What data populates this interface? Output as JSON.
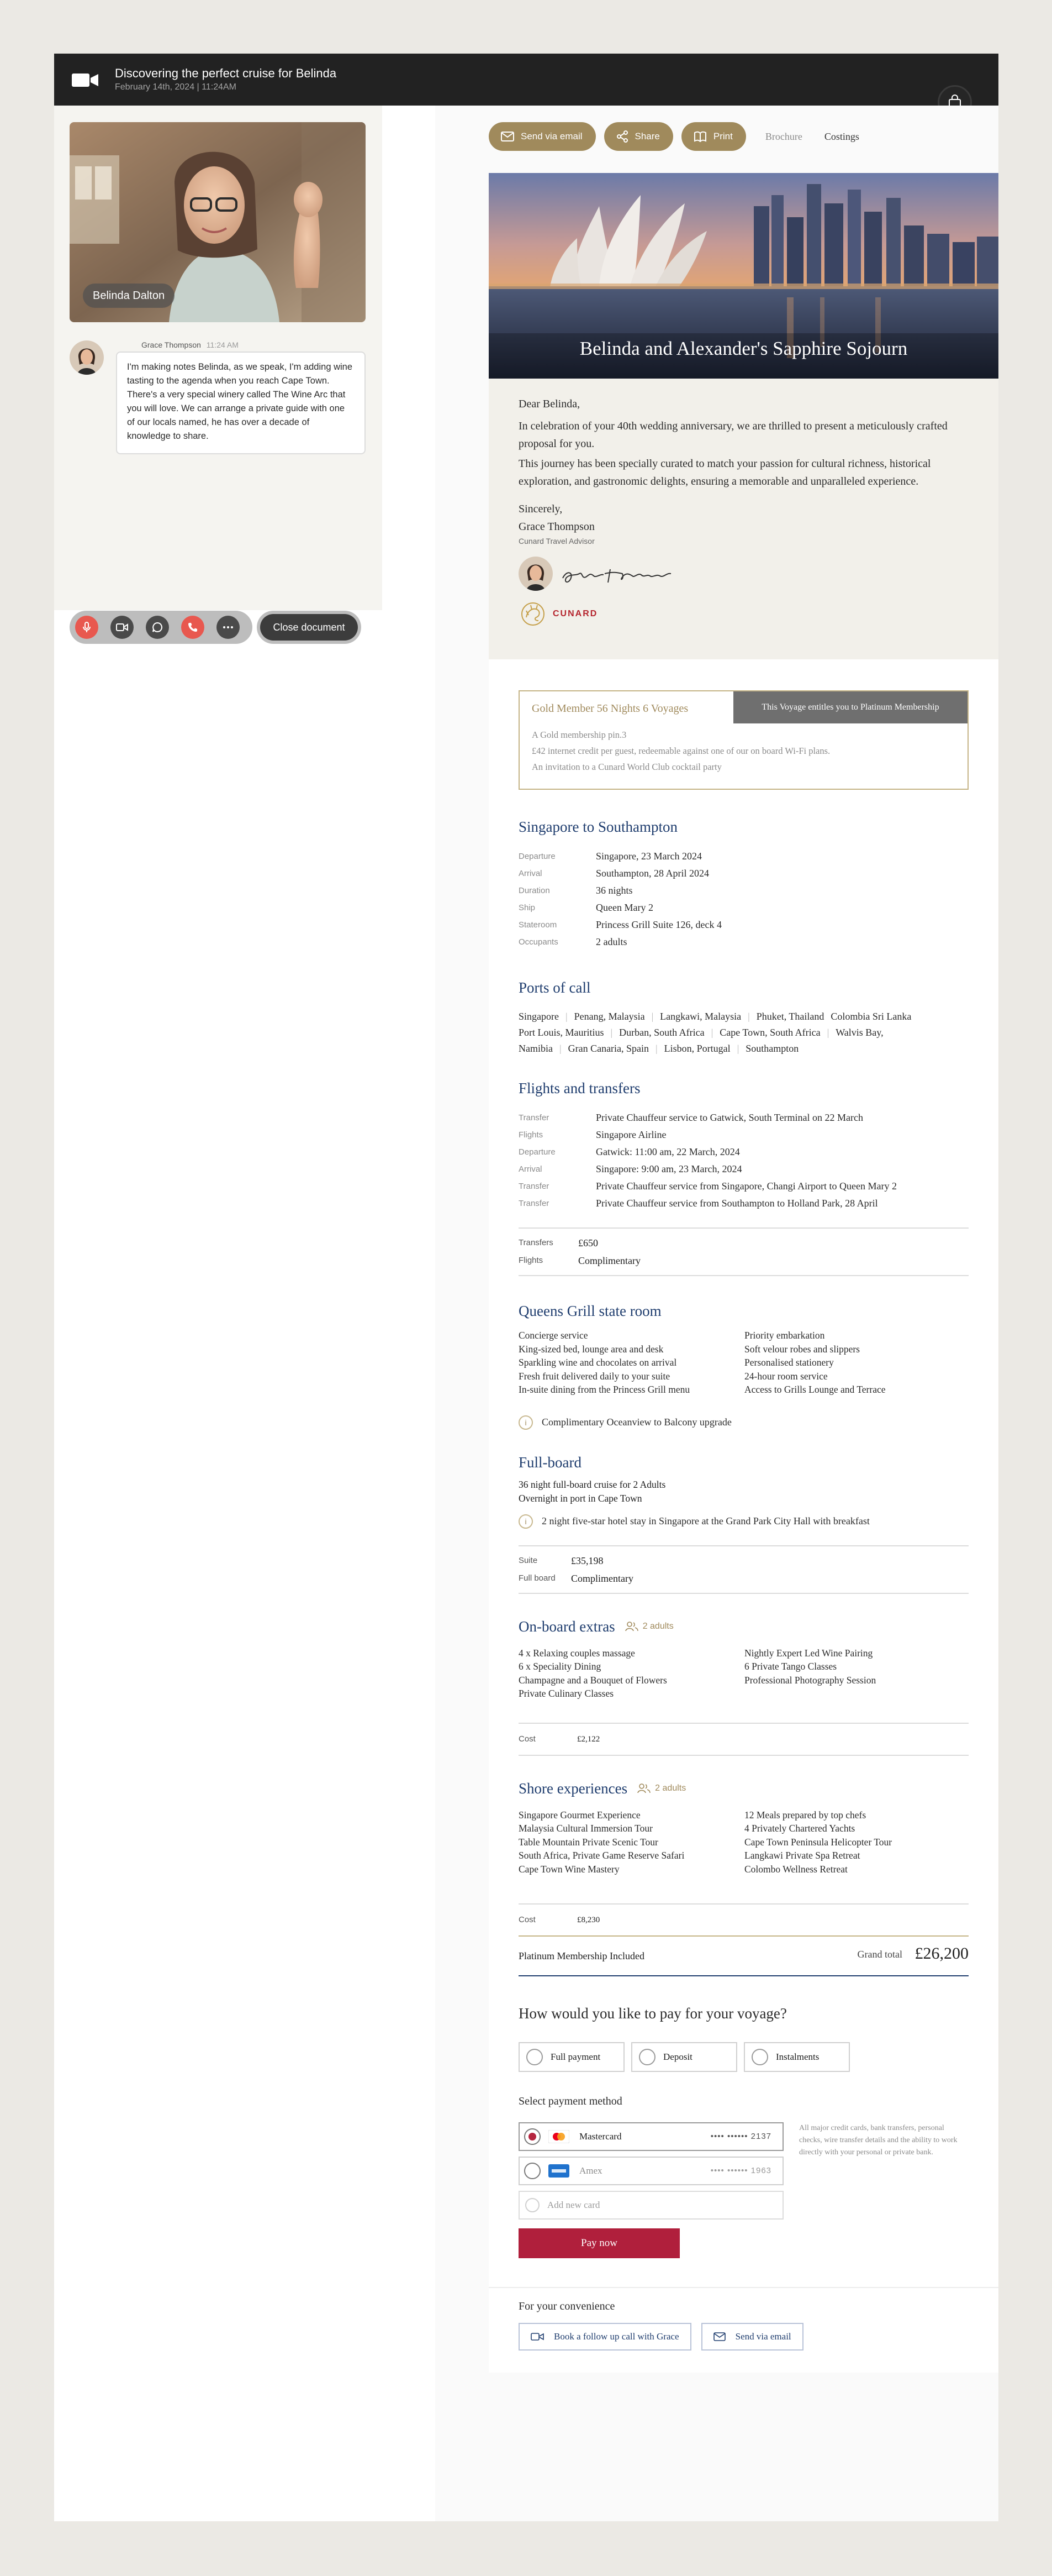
{
  "call": {
    "title": "Discovering the perfect cruise for Belinda",
    "subtitle": "February 14th, 2024 | 11:24AM",
    "participant_name": "Belinda Dalton"
  },
  "chat": {
    "author": "Grace Thompson",
    "time": "11:24 AM",
    "message": "I'm making notes Belinda, as we speak, I'm adding wine tasting to the agenda when you reach Cape Town. There's a very special winery called The Wine Arc that you will love. We can arrange a private guide with one of our locals named, he has over a decade of knowledge to share."
  },
  "controls": {
    "close_label": "Close document",
    "colors": {
      "mic": "#e8584f",
      "end": "#e8584f",
      "neutral": "#4a4a4a"
    }
  },
  "toolbar": {
    "email": "Send via email",
    "share": "Share",
    "print": "Print",
    "brochure": "Brochure",
    "costings": "Costings"
  },
  "hero": {
    "title": "Belinda and Alexander's Sapphire Sojourn"
  },
  "letter": {
    "greeting": "Dear Belinda,",
    "p1": "In celebration of your 40th wedding anniversary, we are thrilled to present a meticulously crafted proposal for you.",
    "p2": "This journey has been specially curated to match your passion for cultural richness, historical exploration, and gastronomic delights, ensuring a memorable and unparalleled experience.",
    "closing": "Sincerely,",
    "name": "Grace Thompson",
    "role": "Cunard Travel Advisor",
    "signature": "grace thompson",
    "brand": "CUNARD"
  },
  "membership": {
    "title": "Gold Member  56 Nights  6 Voyages",
    "banner": "This Voyage entitles you to Platinum Membership",
    "items": [
      "A Gold membership pin.3",
      "£42 internet credit per guest, redeemable against one of our on board Wi-Fi plans.",
      "An invitation to a Cunard World Club cocktail party"
    ]
  },
  "route": {
    "title": "Singapore to Southampton",
    "rows": [
      {
        "k": "Departure",
        "v": "Singapore, 23 March 2024"
      },
      {
        "k": "Arrival",
        "v": "Southampton, 28 April 2024"
      },
      {
        "k": "Duration",
        "v": "36 nights"
      },
      {
        "k": "Ship",
        "v": "Queen Mary 2"
      },
      {
        "k": "Stateroom",
        "v": "Princess Grill Suite 126, deck 4"
      },
      {
        "k": "Occupants",
        "v": "2 adults"
      }
    ]
  },
  "ports": {
    "title": "Ports of call",
    "line1": [
      "Singapore",
      "Penang, Malaysia",
      "Langkawi, Malaysia",
      "Phuket, Thailand",
      "Colombia  Sri Lanka"
    ],
    "line2": [
      "Port Louis, Mauritius",
      "Durban, South Africa",
      "Cape Town, South Africa",
      "Walvis Bay,"
    ],
    "line3": [
      "Namibia",
      "Gran Canaria, Spain",
      "Lisbon, Portugal",
      "Southampton"
    ]
  },
  "flights": {
    "title": "Flights and transfers",
    "rows": [
      {
        "k": "Transfer",
        "v": "Private Chauffeur service to Gatwick, South Terminal on 22 March"
      },
      {
        "k": "Flights",
        "v": "Singapore Airline"
      },
      {
        "k": "Departure",
        "v": "Gatwick: 11:00 am,  22 March, 2024"
      },
      {
        "k": "Arrival",
        "v": "Singapore: 9:00 am,  23 March, 2024"
      },
      {
        "k": "Transfer",
        "v": "Private Chauffeur service from Singapore, Changi Airport to Queen Mary 2"
      },
      {
        "k": "Transfer",
        "v": "Private Chauffeur service from Southampton to Holland Park, 28 April"
      }
    ],
    "costs": [
      {
        "k": "Transfers",
        "v": "£650"
      },
      {
        "k": "Flights",
        "v": "Complimentary"
      }
    ]
  },
  "grill": {
    "title": "Queens Grill state room",
    "left": [
      "Concierge service",
      "King-sized bed, lounge area and desk",
      "Sparkling wine and chocolates on arrival",
      "Fresh fruit delivered daily to your suite",
      "In-suite dining from the Princess Grill menu"
    ],
    "right": [
      "Priority embarkation",
      "Soft velour robes and slippers",
      "Personalised stationery",
      "24-hour room service",
      "Access to Grills Lounge and Terrace"
    ],
    "note": "Complimentary Oceanview to Balcony upgrade"
  },
  "fullboard": {
    "title": "Full-board",
    "lines": [
      "36 night full-board cruise for 2 Adults",
      "Overnight in port in Cape Town"
    ],
    "note": "2 night five-star hotel stay in Singapore at the Grand Park City Hall with breakfast",
    "costs": [
      {
        "k": "Suite",
        "v": "£35,198"
      },
      {
        "k": "Full board",
        "v": "Complimentary"
      }
    ]
  },
  "extras": {
    "title": "On-board extras",
    "adults": "2 adults",
    "left": [
      "4 x Relaxing couples massage",
      "6 x Speciality Dining",
      "Champagne and a Bouquet of Flowers",
      "Private Culinary Classes"
    ],
    "right": [
      "Nightly Expert Led Wine Pairing",
      "6 Private Tango Classes",
      "Professional Photography Session"
    ],
    "cost_label": "Cost",
    "cost": "£2,122"
  },
  "shore": {
    "title": "Shore experiences",
    "adults": "2 adults",
    "left": [
      "Singapore Gourmet Experience",
      "Malaysia Cultural Immersion Tour",
      "Table Mountain Private Scenic Tour",
      "South Africa, Private Game Reserve Safari",
      "Cape Town Wine Mastery"
    ],
    "right": [
      "12 Meals prepared by top chefs",
      "4 Privately Chartered Yachts",
      "Cape Town Peninsula Helicopter Tour",
      "Langkawi Private Spa Retreat",
      "Colombo Wellness Retreat"
    ],
    "cost_label": "Cost",
    "cost": "£8,230"
  },
  "total": {
    "membership": "Platinum Membership Included",
    "label": "Grand total",
    "amount": "£26,200"
  },
  "payment": {
    "question": "How would you like to pay for your voyage?",
    "options": [
      "Full payment",
      "Deposit",
      "Instalments"
    ],
    "method_title": "Select payment method",
    "cards": [
      {
        "name": "Mastercard",
        "number": "•••• •••••• 2137"
      },
      {
        "name": "Amex",
        "number": "•••• •••••• 1963"
      }
    ],
    "add_card": "Add new card",
    "help": "All major credit cards, bank transfers, personal checks, wire transfer details and the ability to work directly with your personal or private bank.",
    "pay_now": "Pay now"
  },
  "convenience": {
    "title": "For your convenience",
    "followup": "Book a follow up call with Grace",
    "email": "Send via email"
  }
}
